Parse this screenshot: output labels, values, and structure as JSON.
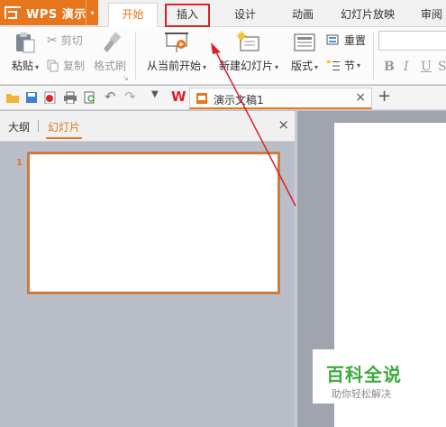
{
  "app": {
    "name": "WPS 演示",
    "menu_caret": "▾"
  },
  "tabs": [
    {
      "label": "开始"
    },
    {
      "label": "插入"
    },
    {
      "label": "设计"
    },
    {
      "label": "动画"
    },
    {
      "label": "幻灯片放映"
    },
    {
      "label": "审阅"
    }
  ],
  "ribbon": {
    "paste": "粘贴",
    "cut": "剪切",
    "copy": "复制",
    "format_painter": "格式刷",
    "from_current": "从当前开始",
    "new_slide": "新建幻灯片",
    "layout": "版式",
    "reset": "重置",
    "section": "节",
    "bold": "B",
    "italic": "I",
    "underline": "U",
    "strike": "S"
  },
  "document": {
    "tab_title": "演示文稿1",
    "close": "×",
    "add": "+"
  },
  "panel": {
    "outline_tab": "大纲",
    "slides_tab": "幻灯片",
    "close": "×",
    "slide_number": "1"
  },
  "watermark": {
    "title": "百科全说",
    "subtitle": "助你轻松解决"
  },
  "colors": {
    "accent": "#e7761d",
    "highlight": "#d9222a",
    "watermark_green": "#3cab3c"
  }
}
